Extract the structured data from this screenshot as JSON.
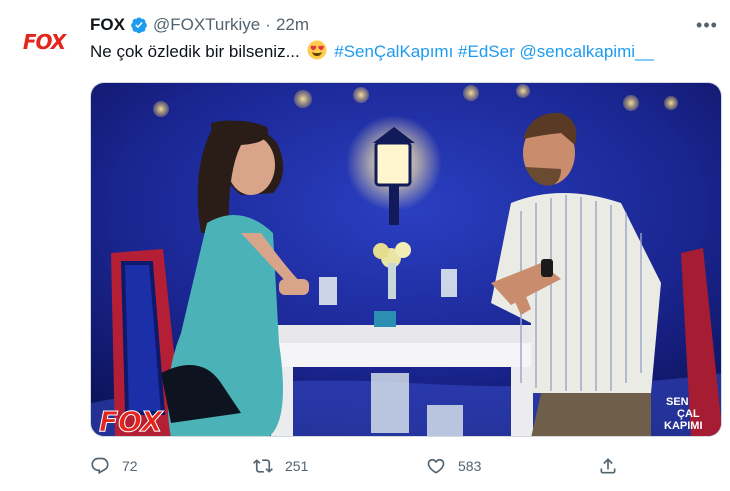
{
  "tweet": {
    "avatar_text": "FOX",
    "display_name": "FOX",
    "handle": "@FOXTurkiye",
    "separator": "·",
    "time": "22m",
    "more_label": "•••",
    "text_plain": "Ne çok özledik bir bilseniz...",
    "hashtag_1": "#SenÇalKapımı",
    "hashtag_2": "#EdSer",
    "mention": "@sencalkapimi__",
    "media": {
      "watermark_logo": "FOX",
      "show_logo_line_1": "SEN",
      "show_logo_line_2": "ÇAL",
      "show_logo_line_3": "KAPIMI"
    },
    "stats": {
      "replies": "72",
      "retweets": "251",
      "likes": "583"
    },
    "colors": {
      "link": "#1d9bf0",
      "muted": "#536471",
      "verified": "#1d9bf0",
      "fox_red": "#e3261b"
    },
    "icons": [
      "verified-badge-icon",
      "heart-eyes-emoji-icon",
      "more-icon",
      "reply-icon",
      "retweet-icon",
      "like-icon",
      "share-icon"
    ]
  }
}
